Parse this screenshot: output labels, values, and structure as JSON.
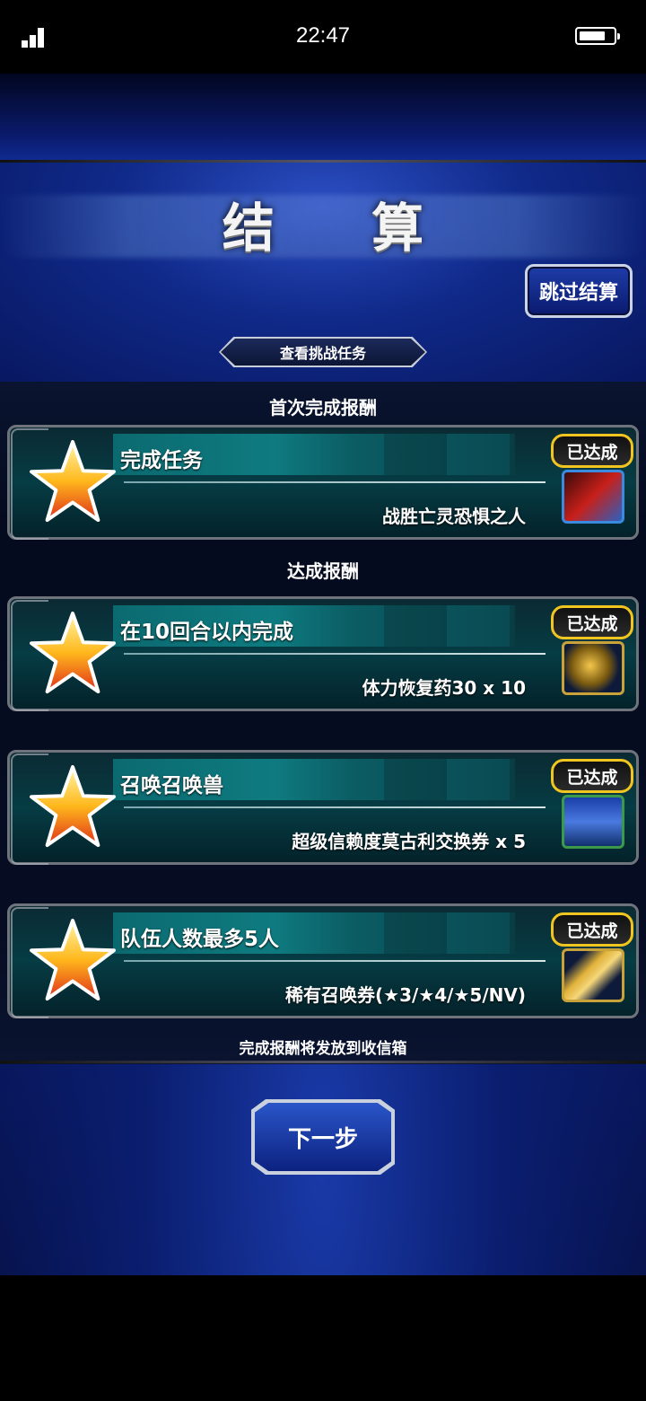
{
  "status_bar": {
    "time": "22:47",
    "signal_icon": "signal-icon",
    "battery_icon": "battery-icon"
  },
  "header": {
    "title": "结 算",
    "skip_button": "跳过结算",
    "challenge_button": "查看挑战任务"
  },
  "sections": {
    "first_clear": "首次完成报酬",
    "achievement": "达成报酬"
  },
  "tasks": [
    {
      "name": "完成任务",
      "reward": "战胜亡灵恐惧之人",
      "badge": "已达成",
      "icon": "sword-slash-icon"
    },
    {
      "name": "在10回合以内完成",
      "reward": "体力恢复药30 x 10",
      "badge": "已达成",
      "icon": "potion-icon"
    },
    {
      "name": "召唤召唤兽",
      "reward": "超级信赖度莫古利交换券 x 5",
      "badge": "已达成",
      "icon": "moogle-ticket-icon"
    },
    {
      "name": "队伍人数最多5人",
      "reward": "稀有召唤券(★3/★4/★5/NV)",
      "badge": "已达成",
      "icon": "summon-ticket-icon"
    }
  ],
  "footer": {
    "mailbox_note": "完成报酬将发放到收信箱",
    "next_button": "下一步"
  },
  "colors": {
    "badge_border": "#f1c520",
    "card_teal": "#0e7b80",
    "background_blue": "#0b1f7a"
  }
}
